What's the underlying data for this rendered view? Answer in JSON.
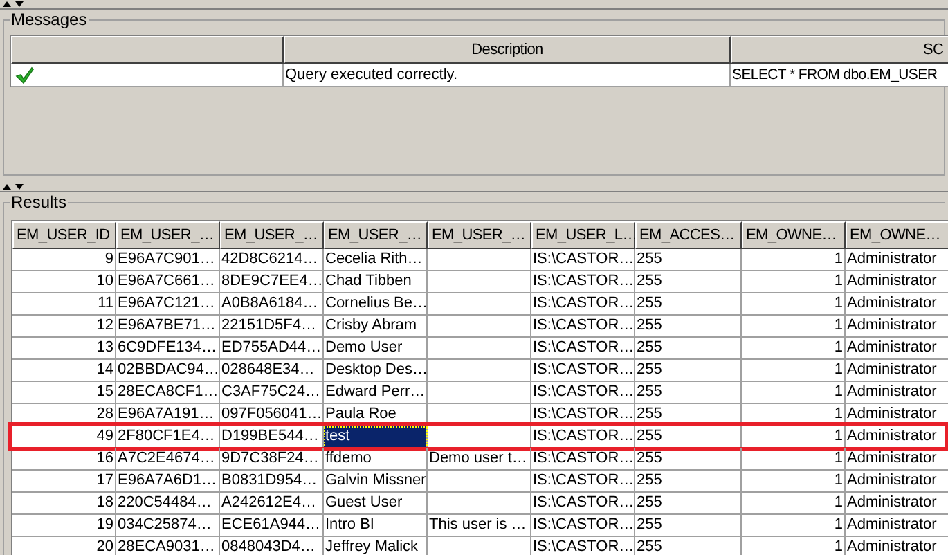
{
  "messages": {
    "title": "Messages",
    "columns": [
      "",
      "Description",
      "SC"
    ],
    "rows": [
      {
        "kind": "success",
        "description": "Query executed correctly.",
        "sql": "SELECT * FROM dbo.EM_USER"
      }
    ]
  },
  "results": {
    "title": "Results",
    "columns": [
      "EM_USER_ID",
      "EM_USER_…",
      "EM_USER_…",
      "EM_USER_…",
      "EM_USER_…",
      "EM_USER_L…",
      "EM_ACCES…",
      "EM_OWNE…",
      "EM_OWNE…"
    ],
    "rows": [
      {
        "cells": [
          "9",
          "E96A7C901…",
          "42D8C6214…",
          "Cecelia Rith…",
          "",
          "IS:\\CASTOR…",
          "255",
          "1",
          "Administrator"
        ],
        "selected": false,
        "highlighted": false
      },
      {
        "cells": [
          "10",
          "E96A7C661…",
          "8DE9C7EE4…",
          "Chad Tibben",
          "",
          "IS:\\CASTOR…",
          "255",
          "1",
          "Administrator"
        ],
        "selected": false,
        "highlighted": false
      },
      {
        "cells": [
          "11",
          "E96A7C121…",
          "A0B8A6184…",
          "Cornelius Be…",
          "",
          "IS:\\CASTOR…",
          "255",
          "1",
          "Administrator"
        ],
        "selected": false,
        "highlighted": false
      },
      {
        "cells": [
          "12",
          "E96A7BE71…",
          "22151D5F4…",
          "Crisby Abram",
          "",
          "IS:\\CASTOR…",
          "255",
          "1",
          "Administrator"
        ],
        "selected": false,
        "highlighted": false
      },
      {
        "cells": [
          "13",
          "6C9DFE134…",
          "ED755AD44…",
          "Demo User",
          "",
          "IS:\\CASTOR…",
          "255",
          "1",
          "Administrator"
        ],
        "selected": false,
        "highlighted": false
      },
      {
        "cells": [
          "14",
          "02BBDAC94…",
          "028648E34…",
          "Desktop Des…",
          "",
          "IS:\\CASTOR…",
          "255",
          "1",
          "Administrator"
        ],
        "selected": false,
        "highlighted": false
      },
      {
        "cells": [
          "15",
          "28ECA8CF1…",
          "C3AF75C24…",
          "Edward Perr…",
          "",
          "IS:\\CASTOR…",
          "255",
          "1",
          "Administrator"
        ],
        "selected": false,
        "highlighted": false
      },
      {
        "cells": [
          "28",
          "E96A7A191…",
          "097F056041…",
          "Paula Roe",
          "",
          "IS:\\CASTOR…",
          "255",
          "1",
          "Administrator"
        ],
        "selected": false,
        "highlighted": false
      },
      {
        "cells": [
          "49",
          "2F80CF1E4…",
          "D199BE544…",
          "test",
          "",
          "IS:\\CASTOR…",
          "255",
          "1",
          "Administrator"
        ],
        "selected": true,
        "highlighted": true
      },
      {
        "cells": [
          "16",
          "A7C2E4674…",
          "9D7C38F24…",
          "ffdemo",
          "Demo user t…",
          "IS:\\CASTOR…",
          "255",
          "1",
          "Administrator"
        ],
        "selected": false,
        "highlighted": false
      },
      {
        "cells": [
          "17",
          "E96A7A6D1…",
          "B0831D954…",
          "Galvin Missner",
          "",
          "IS:\\CASTOR…",
          "255",
          "1",
          "Administrator"
        ],
        "selected": false,
        "highlighted": false
      },
      {
        "cells": [
          "18",
          "220C54484…",
          "A242612E4…",
          "Guest User",
          "",
          "IS:\\CASTOR…",
          "255",
          "1",
          "Administrator"
        ],
        "selected": false,
        "highlighted": false
      },
      {
        "cells": [
          "19",
          "034C25874…",
          "ECE61A944…",
          "Intro BI",
          "This user is …",
          "IS:\\CASTOR…",
          "255",
          "1",
          "Administrator"
        ],
        "selected": false,
        "highlighted": false
      },
      {
        "cells": [
          "20",
          "28ECA9031…",
          "0848043D4…",
          "Jeffrey Malick",
          "",
          "IS:\\CASTOR…",
          "255",
          "1",
          "Administrator"
        ],
        "selected": false,
        "highlighted": false
      }
    ]
  }
}
